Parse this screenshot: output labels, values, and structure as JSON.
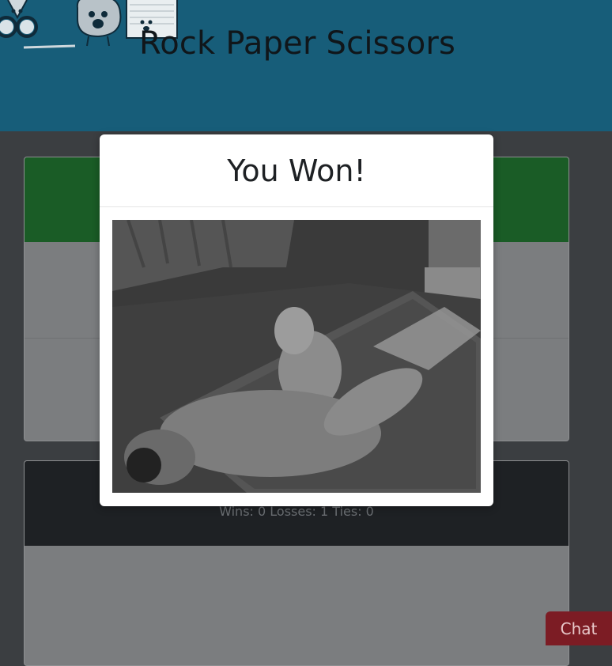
{
  "header": {
    "title": "Rock Paper Scissors",
    "background": "#175d79"
  },
  "result_modal": {
    "title": "You Won!",
    "image_alt": "celebration cat gif"
  },
  "scoreboard": {
    "text": "Wins: 0 Losses: 1 Ties: 0"
  },
  "chat": {
    "label": "Chat",
    "color": "#7c1c24"
  },
  "colors": {
    "player_panel_header": "#1a5c26",
    "score_panel_header": "#1e2124",
    "overlay_background": "#3b3e41"
  },
  "icons": [
    "scissors-character",
    "rock-character",
    "paper-character"
  ]
}
